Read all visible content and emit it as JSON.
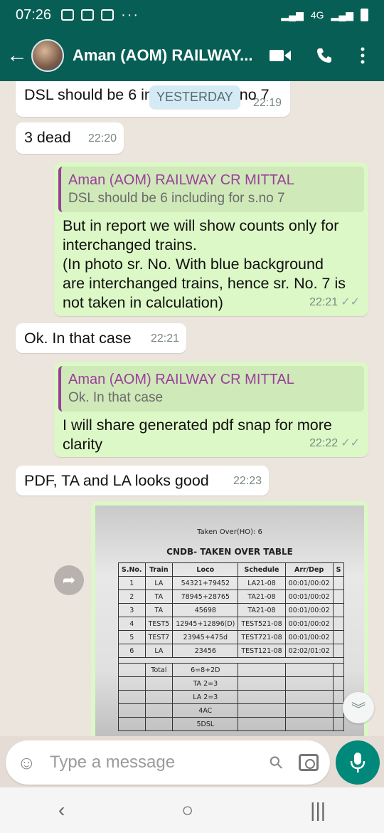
{
  "status_bar": {
    "time": "07:26",
    "more": "···",
    "network": "4G"
  },
  "header": {
    "back_icon": "arrow-left-icon",
    "title": "Aman (AOM) RAILWAY...",
    "video_icon": "video-camera-icon",
    "call_icon": "phone-icon",
    "menu_icon": "more-vertical-icon"
  },
  "date_chip": "YESTERDAY",
  "messages": [
    {
      "text": "DSL should be 6 including for s.no 7",
      "time": "22:19",
      "side": "in"
    },
    {
      "text": "3 dead",
      "time": "22:20",
      "side": "in"
    },
    {
      "quote_author": "Aman (AOM) RAILWAY CR MITTAL",
      "quote_text": "DSL should be 6 including for s.no 7",
      "text_lines": [
        "But in report we will show counts only for",
        "interchanged trains.",
        "(In photo sr. No. With blue background",
        "are interchanged trains, hence sr. No. 7 is",
        "not taken in calculation)"
      ],
      "time": "22:21",
      "side": "out"
    },
    {
      "text": "Ok. In that case",
      "time": "22:21",
      "side": "in"
    },
    {
      "quote_author": "Aman (AOM) RAILWAY CR MITTAL",
      "quote_text": "Ok. In that case",
      "text_lines": [
        "I will share generated pdf snap for more",
        "clarity"
      ],
      "time": "22:22",
      "side": "out"
    },
    {
      "text": "PDF, TA and LA looks good",
      "time": "22:23",
      "side": "in"
    }
  ],
  "photo": {
    "subtitle": "Taken Over(HO): 6",
    "title": "CNDB- TAKEN OVER TABLE",
    "headers": [
      "S.No.",
      "Train",
      "Loco",
      "Schedule",
      "Arr/Dep",
      "S"
    ],
    "rows": [
      [
        "1",
        "LA",
        "54321+79452",
        "LA21-08",
        "00:01/00:02"
      ],
      [
        "2",
        "TA",
        "78945+28765",
        "TA21-08",
        "00:01/00:02"
      ],
      [
        "3",
        "TA",
        "45698",
        "TA21-08",
        "00:01/00:02"
      ],
      [
        "4",
        "TEST5",
        "12945+12896(D)",
        "TEST521-08",
        "00:01/00:02"
      ],
      [
        "5",
        "TEST7",
        "23945+475d",
        "TEST721-08",
        "00:01/00:02"
      ],
      [
        "6",
        "LA",
        "23456",
        "TEST121-08",
        "02:02/01:02"
      ]
    ],
    "summary": [
      [
        "Total",
        "6=8+2D"
      ],
      [
        "",
        "TA 2=3"
      ],
      [
        "",
        "LA 2=3"
      ],
      [
        "",
        "4AC"
      ],
      [
        "",
        "5DSL"
      ]
    ]
  },
  "composer": {
    "placeholder": "Type a message",
    "emoji_icon": "smiley-icon",
    "attach_icon": "paperclip-icon",
    "camera_icon": "camera-icon",
    "mic_icon": "microphone-icon"
  },
  "colors": {
    "header": "#075e54",
    "outgoing": "#dcf8c6",
    "incoming": "#ffffff",
    "accent": "#00897b",
    "quote_author": "#9b3e9b"
  }
}
